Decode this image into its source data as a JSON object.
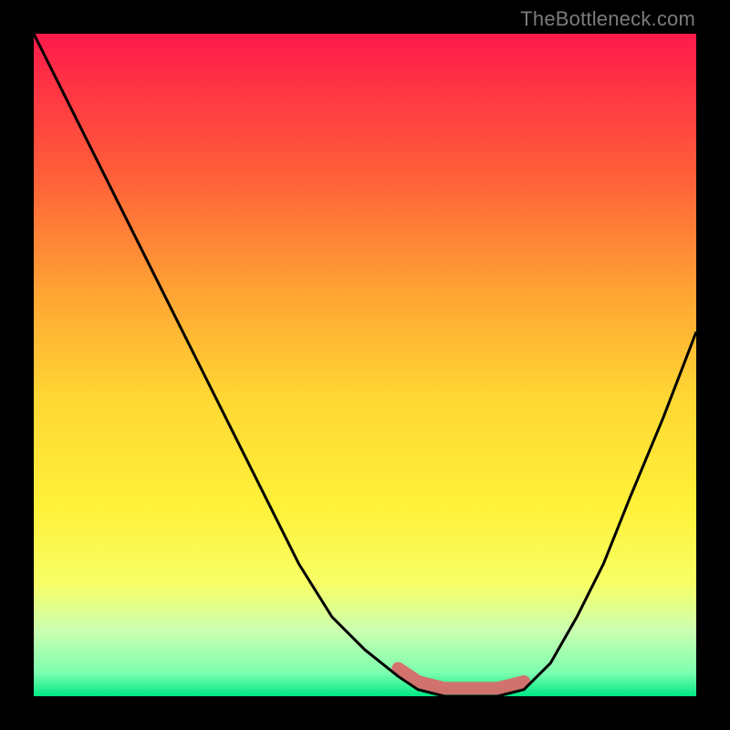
{
  "watermark": "TheBottleneck.com",
  "chart_data": {
    "type": "line",
    "title": "",
    "xlabel": "",
    "ylabel": "",
    "xlim": [
      0,
      100
    ],
    "ylim": [
      0,
      100
    ],
    "series": [
      {
        "name": "curve",
        "x": [
          0,
          5,
          10,
          15,
          20,
          25,
          30,
          35,
          40,
          45,
          50,
          55,
          58,
          62,
          66,
          70,
          74,
          78,
          82,
          86,
          90,
          95,
          100
        ],
        "y": [
          100,
          90,
          80,
          70,
          60,
          50,
          40,
          30,
          20,
          12,
          7,
          3,
          1,
          0,
          0,
          0,
          1,
          5,
          12,
          20,
          30,
          42,
          55
        ]
      }
    ],
    "background_gradient": {
      "stops": [
        {
          "offset": 0.0,
          "color": "#ff1a4b"
        },
        {
          "offset": 0.2,
          "color": "#ff5a3a"
        },
        {
          "offset": 0.4,
          "color": "#ffa733"
        },
        {
          "offset": 0.55,
          "color": "#ffd733"
        },
        {
          "offset": 0.72,
          "color": "#fff23a"
        },
        {
          "offset": 0.83,
          "color": "#f7ff66"
        },
        {
          "offset": 0.9,
          "color": "#ccffb0"
        },
        {
          "offset": 0.965,
          "color": "#7cffaf"
        },
        {
          "offset": 1.0,
          "color": "#00e884"
        }
      ]
    },
    "highlight": {
      "color": "#d96a6a",
      "x_range": [
        55,
        74
      ],
      "y": 1
    }
  }
}
